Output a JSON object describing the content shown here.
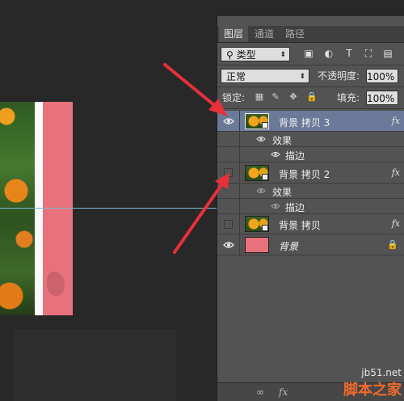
{
  "tabs": [
    {
      "label": "图层"
    },
    {
      "label": "通道"
    },
    {
      "label": "路径"
    }
  ],
  "filter": {
    "label": "类型"
  },
  "blend": {
    "mode": "正常",
    "opacity_label": "不透明度:",
    "opacity_value": "100%"
  },
  "lock": {
    "label": "锁定:",
    "fill_label": "填充:",
    "fill_value": "100%"
  },
  "layers": [
    {
      "name": "背景 拷贝 3",
      "visible": true,
      "selected": true,
      "fx": "fx",
      "effects_label": "效果",
      "effect_item": "描边"
    },
    {
      "name": "背景 拷贝 2",
      "visible": false,
      "selected": false,
      "fx": "fx",
      "effects_label": "效果",
      "effect_item": "描边"
    },
    {
      "name": "背景 拷贝",
      "visible": false,
      "selected": false,
      "fx": "fx"
    },
    {
      "name": "背景",
      "visible": true,
      "selected": false
    }
  ],
  "footer": {
    "link": "∞",
    "fx": "fx"
  },
  "watermark": {
    "site": "jb51.net",
    "name": "脚本之家"
  },
  "colors": {
    "arrow": "#e8303a",
    "selected_row": "#6a7a98",
    "panel": "#535353",
    "canvas_bg": "#282828",
    "doc_pink": "#e8727b"
  }
}
